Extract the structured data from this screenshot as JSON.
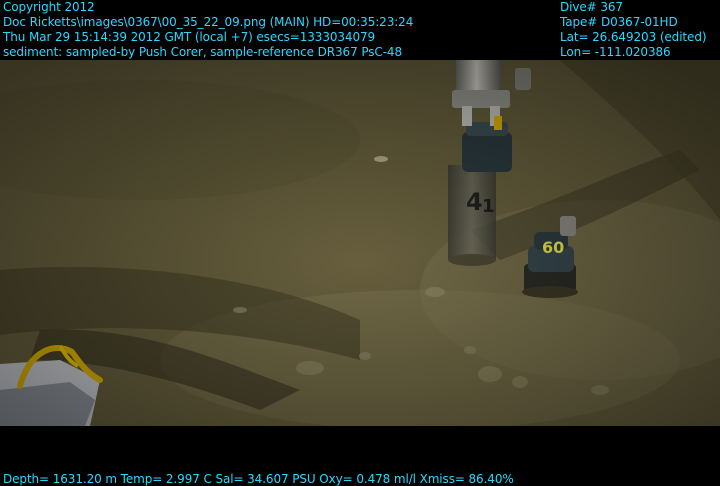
{
  "overlay": {
    "copyright": "Copyright 2012",
    "image_path": "Doc Ricketts\\images\\0367\\00_35_22_09.png (MAIN)  HD=00:35:23:24",
    "datetime": "Thu Mar 29 15:14:39 2012 GMT (local +7)  esecs=1333034079",
    "sediment": "sediment: sampled-by Push Corer, sample-reference DR367 PsC-48",
    "dive": "Dive# 367",
    "tape": "Tape# D0367-01HD",
    "lat": "Lat= 26.649203 (edited)",
    "lon": "Lon= -111.020386",
    "sensors": "Depth= 1631.20 m  Temp= 2.997 C  Sal= 34.607 PSU  Oxy= 0.478 ml/l  Xmiss= 86.40%"
  },
  "scene": {
    "core_labels": [
      "41",
      "60"
    ]
  },
  "colors": {
    "overlay_text": "#2ad8ff",
    "seafloor": "#6a6440",
    "gripper_yellow": "#e0b400"
  }
}
